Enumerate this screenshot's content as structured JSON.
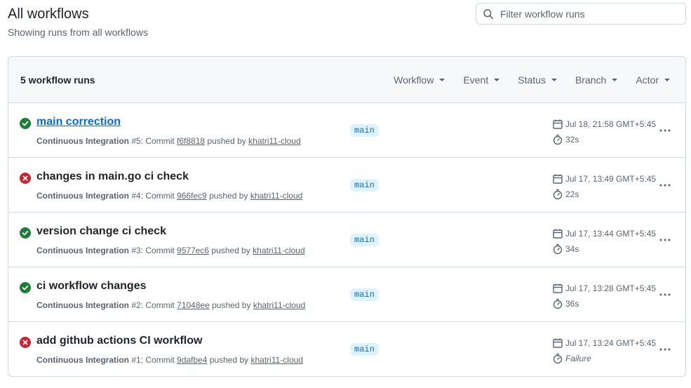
{
  "header": {
    "title": "All workflows",
    "subtitle": "Showing runs from all workflows"
  },
  "search": {
    "placeholder": "Filter workflow runs",
    "value": ""
  },
  "list": {
    "count_label": "5 workflow runs",
    "filters": [
      "Workflow",
      "Event",
      "Status",
      "Branch",
      "Actor"
    ]
  },
  "runs": [
    {
      "title": "main correction",
      "status": "success",
      "workflow": "Continuous Integration",
      "number": "#5",
      "commit_prefix": ": Commit",
      "commit": "f6f8818",
      "pushed_by": "pushed by",
      "actor": "khatri11-cloud",
      "branch": "main",
      "date": "Jul 18, 21:58 GMT+5:45",
      "duration": "32s"
    },
    {
      "title": "changes in main.go ci check",
      "status": "failure",
      "workflow": "Continuous Integration",
      "number": "#4",
      "commit_prefix": ": Commit",
      "commit": "966fec9",
      "pushed_by": "pushed by",
      "actor": "khatri11-cloud",
      "branch": "main",
      "date": "Jul 17, 13:49 GMT+5:45",
      "duration": "22s"
    },
    {
      "title": "version change ci check",
      "status": "success",
      "workflow": "Continuous Integration",
      "number": "#3",
      "commit_prefix": ": Commit",
      "commit": "9577ec6",
      "pushed_by": "pushed by",
      "actor": "khatri11-cloud",
      "branch": "main",
      "date": "Jul 17, 13:44 GMT+5:45",
      "duration": "34s"
    },
    {
      "title": "ci workflow changes",
      "status": "success",
      "workflow": "Continuous Integration",
      "number": "#2",
      "commit_prefix": ": Commit",
      "commit": "71048ee",
      "pushed_by": "pushed by",
      "actor": "khatri11-cloud",
      "branch": "main",
      "date": "Jul 17, 13:28 GMT+5:45",
      "duration": "36s"
    },
    {
      "title": "add github actions CI workflow",
      "status": "failure",
      "workflow": "Continuous Integration",
      "number": "#1",
      "commit_prefix": ": Commit",
      "commit": "9dafbe4",
      "pushed_by": "pushed by",
      "actor": "khatri11-cloud",
      "branch": "main",
      "date": "Jul 17, 13:24 GMT+5:45",
      "duration": "Failure"
    }
  ],
  "colors": {
    "success": "#1a7f37",
    "failure": "#cf222e",
    "link": "#0969da",
    "muted": "#59636e",
    "branch_bg": "#ddf4ff"
  },
  "icons": {
    "search": "search-icon",
    "success": "check-circle-fill-icon",
    "failure": "x-circle-fill-icon",
    "calendar": "calendar-icon",
    "stopwatch": "stopwatch-icon",
    "menu": "kebab-horizontal-icon"
  }
}
